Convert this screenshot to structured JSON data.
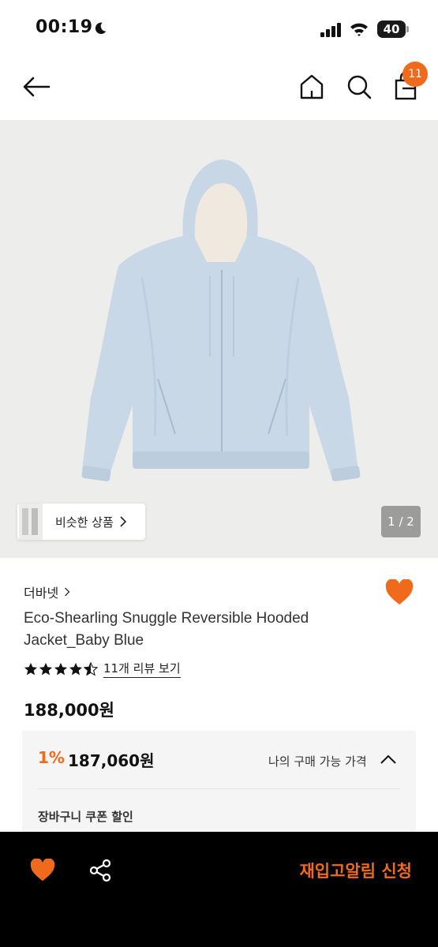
{
  "status_bar": {
    "time": "00:19",
    "battery": "40"
  },
  "nav": {
    "cart_count": "11"
  },
  "gallery": {
    "similar_label": "비슷한 상품",
    "image_counter": "1 / 2"
  },
  "product": {
    "brand": "더바넷",
    "title": "Eco-Shearling Snuggle Reversible Hooded Jacket_Baby Blue",
    "rating": 4.5,
    "review_link": "11개 리뷰 보기",
    "price": "188,000원"
  },
  "price_box": {
    "discount_rate": "1%",
    "discount_price": "187,060원",
    "my_price_label": "나의 구매 가능 가격",
    "coupon_label": "장바구니 쿠폰 할인"
  },
  "bottom_bar": {
    "restock_button": "재입고알림 신청"
  },
  "colors": {
    "accent": "#f06a1d",
    "bottom_bar_bg": "#000000",
    "price_box_bg": "#f5f5f5",
    "jacket": "#c9d8e6"
  },
  "icons": [
    "back-arrow-icon",
    "home-icon",
    "search-icon",
    "shopping-bag-icon",
    "heart-icon",
    "share-icon",
    "star-icon",
    "chevron-right-icon",
    "chevron-up-icon",
    "moon-icon",
    "signal-icon",
    "wifi-icon",
    "battery-icon"
  ]
}
